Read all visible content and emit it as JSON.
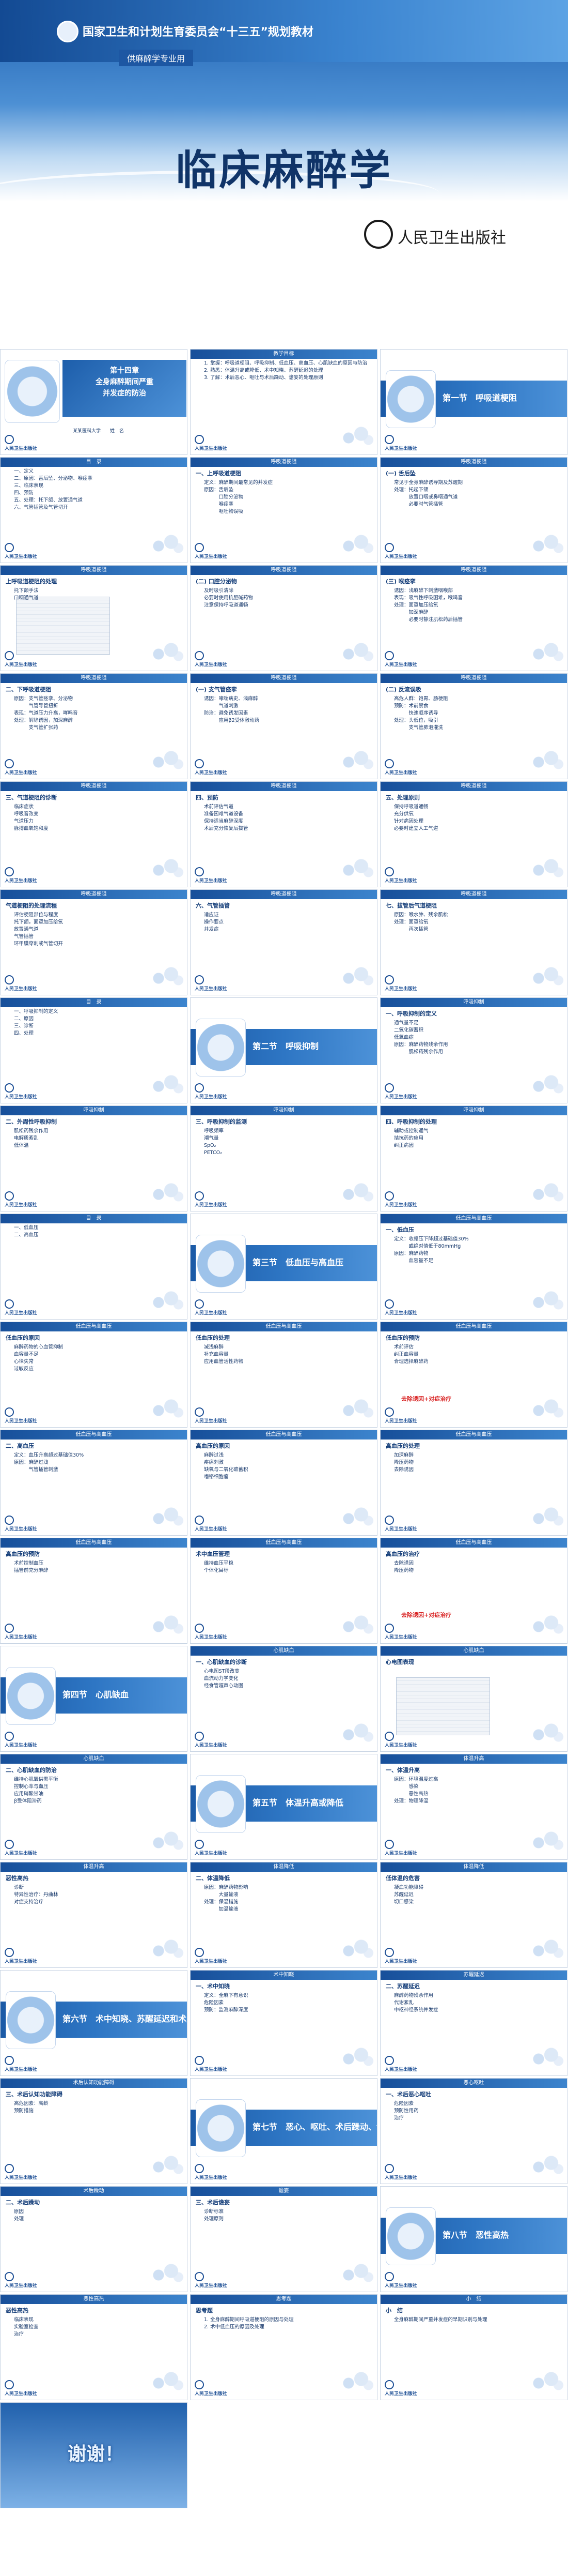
{
  "cover": {
    "series": "国家卫生和计划生育委员会“十三五”规划教材",
    "subtitle": "供麻醉学专业用",
    "title": "临床麻醉学",
    "publisher": "人民卫生出版社"
  },
  "common": {
    "footer": "人民卫生出版社",
    "header_default": "呼吸道梗阻"
  },
  "slides": [
    {
      "kind": "title",
      "title_lines": [
        "第十四章",
        "全身麻醉期间严重",
        "并发症的防治"
      ],
      "affiliation": "某某医科大学　　姓　名"
    },
    {
      "kind": "text",
      "hdr": "教学目标",
      "ttl": "",
      "items": [
        "1. 掌握：呼吸道梗阻、呼吸抑制、低血压、高血压、心肌缺血的原因与防治",
        "2. 熟悉：体温升高或降低、术中知晓、苏醒延迟的处理",
        "3. 了解：术后恶心、呕吐与术后躁动、谵妄的处理原则"
      ]
    },
    {
      "kind": "section",
      "sect": "第一节　呼吸道梗阻"
    },
    {
      "kind": "text",
      "hdr": "目　录",
      "ttl": "",
      "items": [
        "一、定义",
        "二、原因：舌后坠、分泌物、喉痉挛",
        "三、临床表现",
        "四、预防",
        "五、处理：托下颌、放置通气道",
        "六、气管插管及气管切开"
      ]
    },
    {
      "kind": "text",
      "hdr": "呼吸道梗阻",
      "ttl": "一、上呼吸道梗阻",
      "items": [
        "定义：麻醉期间最常见的并发症",
        "原因：舌后坠",
        "　　　口腔分泌物",
        "　　　喉痉挛",
        "　　　呕吐物误吸"
      ]
    },
    {
      "kind": "text",
      "hdr": "呼吸道梗阻",
      "ttl": "(一) 舌后坠",
      "items": [
        "常见于全身麻醉诱导期及苏醒期",
        "处理：托起下颌",
        "　　　放置口咽或鼻咽通气道",
        "　　　必要时气管插管"
      ]
    },
    {
      "kind": "image",
      "hdr": "呼吸道梗阻",
      "ttl": "上呼吸道梗阻的处理",
      "items": [
        "托下颌手法",
        "口咽通气道"
      ]
    },
    {
      "kind": "text",
      "hdr": "呼吸道梗阻",
      "ttl": "(二) 口腔分泌物",
      "items": [
        "及时吸引清除",
        "必要时使用抗胆碱药物",
        "注意保持呼吸道通畅"
      ]
    },
    {
      "kind": "text",
      "hdr": "呼吸道梗阻",
      "ttl": "(三) 喉痉挛",
      "items": [
        "诱因：浅麻醉下刺激咽喉部",
        "表现：吸气性呼吸困难，喉鸣音",
        "处理：面罩加压给氧",
        "　　　加深麻醉",
        "　　　必要时静注肌松药后插管"
      ]
    },
    {
      "kind": "text",
      "hdr": "呼吸道梗阻",
      "ttl": "二、下呼吸道梗阻",
      "items": [
        "原因：支气管痉挛、分泌物",
        "　　　气管导管扭折",
        "表现：气道压力升高，哮鸣音",
        "处理：解除诱因，加深麻醉",
        "　　　支气管扩张药"
      ]
    },
    {
      "kind": "text",
      "hdr": "呼吸道梗阻",
      "ttl": "(一) 支气管痉挛",
      "items": [
        "诱因：哮喘病史、浅麻醉",
        "　　　气道刺激",
        "防治：避免诱发因素",
        "　　　应用β2受体激动药"
      ]
    },
    {
      "kind": "text",
      "hdr": "呼吸道梗阻",
      "ttl": "(二) 反流误吸",
      "items": [
        "高危人群：饱胃、肠梗阻",
        "预防：术前禁食",
        "　　　快速顺序诱导",
        "处理：头低位，吸引",
        "　　　支气管肺泡灌洗"
      ]
    },
    {
      "kind": "text",
      "hdr": "呼吸道梗阻",
      "ttl": "三、气道梗阻的诊断",
      "items": [
        "临床症状",
        "呼吸音改变",
        "气道压力",
        "脉搏血氧饱和度"
      ]
    },
    {
      "kind": "text",
      "hdr": "呼吸道梗阻",
      "ttl": "四、预防",
      "items": [
        "术前评估气道",
        "准备困难气道设备",
        "保持适当麻醉深度",
        "术后充分恢复后拔管"
      ]
    },
    {
      "kind": "text",
      "hdr": "呼吸道梗阻",
      "ttl": "五、处理原则",
      "items": [
        "保持呼吸道通畅",
        "充分供氧",
        "针对病因处理",
        "必要时建立人工气道"
      ]
    },
    {
      "kind": "text",
      "hdr": "呼吸道梗阻",
      "ttl": "气道梗阻的处理流程",
      "items": [
        "评估梗阻部位与程度",
        "托下颌，面罩加压给氧",
        "放置通气道",
        "气管插管",
        "环甲膜穿刺或气管切开"
      ]
    },
    {
      "kind": "text",
      "hdr": "呼吸道梗阻",
      "ttl": "六、气管插管",
      "items": [
        "适应证",
        "操作要点",
        "并发症"
      ]
    },
    {
      "kind": "text",
      "hdr": "呼吸道梗阻",
      "ttl": "七、拔管后气道梗阻",
      "items": [
        "原因：喉水肿、残余肌松",
        "处理：面罩给氧",
        "　　　再次插管"
      ]
    },
    {
      "kind": "text",
      "hdr": "目　录",
      "ttl": "",
      "items": [
        "一、呼吸抑制的定义",
        "二、原因",
        "三、诊断",
        "四、处理"
      ]
    },
    {
      "kind": "section",
      "sect": "第二节　呼吸抑制"
    },
    {
      "kind": "text",
      "hdr": "呼吸抑制",
      "ttl": "一、呼吸抑制的定义",
      "items": [
        "通气量不足",
        "二氧化碳蓄积",
        "低氧血症",
        "原因：麻醉药物残余作用",
        "　　　肌松药残余作用"
      ]
    },
    {
      "kind": "text",
      "hdr": "呼吸抑制",
      "ttl": "二、外周性呼吸抑制",
      "items": [
        "肌松药残余作用",
        "电解质紊乱",
        "低体温"
      ]
    },
    {
      "kind": "text",
      "hdr": "呼吸抑制",
      "ttl": "三、呼吸抑制的监测",
      "items": [
        "呼吸频率",
        "潮气量",
        "SpO₂",
        "PETCO₂"
      ]
    },
    {
      "kind": "text",
      "hdr": "呼吸抑制",
      "ttl": "四、呼吸抑制的处理",
      "items": [
        "辅助或控制通气",
        "拮抗药的应用",
        "纠正病因"
      ]
    },
    {
      "kind": "text",
      "hdr": "目　录",
      "ttl": "",
      "items": [
        "一、低血压",
        "二、高血压"
      ]
    },
    {
      "kind": "section",
      "sect": "第三节　低血压与高血压"
    },
    {
      "kind": "text",
      "hdr": "低血压与高血压",
      "ttl": "一、低血压",
      "items": [
        "定义：收缩压下降超过基础值30%",
        "　　　或绝对值低于80mmHg",
        "原因：麻醉药物",
        "　　　血容量不足"
      ]
    },
    {
      "kind": "text",
      "hdr": "低血压与高血压",
      "ttl": "低血压的原因",
      "items": [
        "麻醉药物的心血管抑制",
        "血容量不足",
        "心律失常",
        "过敏反应"
      ]
    },
    {
      "kind": "text",
      "hdr": "低血压与高血压",
      "ttl": "低血压的处理",
      "items": [
        "减浅麻醉",
        "补充血容量",
        "应用血管活性药物"
      ]
    },
    {
      "kind": "note",
      "hdr": "低血压与高血压",
      "ttl": "低血压的预防",
      "items": [
        "术前评估",
        "纠正血容量",
        "合理选择麻醉药"
      ],
      "note": "去除诱因+对症治疗"
    },
    {
      "kind": "text",
      "hdr": "低血压与高血压",
      "ttl": "二、高血压",
      "items": [
        "定义：血压升高超过基础值30%",
        "原因：麻醉过浅",
        "　　　气管插管刺激"
      ]
    },
    {
      "kind": "text",
      "hdr": "低血压与高血压",
      "ttl": "高血压的原因",
      "items": [
        "麻醉过浅",
        "疼痛刺激",
        "缺氧与二氧化碳蓄积",
        "嗜铬细胞瘤"
      ]
    },
    {
      "kind": "text",
      "hdr": "低血压与高血压",
      "ttl": "高血压的处理",
      "items": [
        "加深麻醉",
        "降压药物",
        "去除诱因"
      ]
    },
    {
      "kind": "text",
      "hdr": "低血压与高血压",
      "ttl": "高血压的预防",
      "items": [
        "术前控制血压",
        "插管前充分麻醉"
      ]
    },
    {
      "kind": "text",
      "hdr": "低血压与高血压",
      "ttl": "术中血压管理",
      "items": [
        "维持血压平稳",
        "个体化目标"
      ]
    },
    {
      "kind": "note",
      "hdr": "低血压与高血压",
      "ttl": "高血压的治疗",
      "items": [
        "去除诱因",
        "降压药物"
      ],
      "note": "去除诱因+对症治疗"
    },
    {
      "kind": "section",
      "sect": "第四节　心肌缺血"
    },
    {
      "kind": "text",
      "hdr": "心肌缺血",
      "ttl": "一、心肌缺血的诊断",
      "items": [
        "心电图ST段改变",
        "血流动力学变化",
        "经食管超声心动图"
      ]
    },
    {
      "kind": "image",
      "hdr": "心肌缺血",
      "ttl": "心电图表现",
      "items": []
    },
    {
      "kind": "text",
      "hdr": "心肌缺血",
      "ttl": "二、心肌缺血的防治",
      "items": [
        "维持心肌氧供需平衡",
        "控制心率与血压",
        "应用硝酸甘油",
        "β受体阻滞药"
      ]
    },
    {
      "kind": "section",
      "sect": "第五节　体温升高或降低"
    },
    {
      "kind": "text",
      "hdr": "体温升高",
      "ttl": "一、体温升高",
      "items": [
        "原因：环境温度过高",
        "　　　感染",
        "　　　恶性高热",
        "处理：物理降温"
      ]
    },
    {
      "kind": "text",
      "hdr": "体温升高",
      "ttl": "恶性高热",
      "items": [
        "诊断",
        "特异性治疗：丹曲林",
        "对症支持治疗"
      ]
    },
    {
      "kind": "text",
      "hdr": "体温降低",
      "ttl": "二、体温降低",
      "items": [
        "原因：麻醉药物影响",
        "　　　大量输液",
        "处理：保温措施",
        "　　　加温输液"
      ]
    },
    {
      "kind": "text",
      "hdr": "体温降低",
      "ttl": "低体温的危害",
      "items": [
        "凝血功能障碍",
        "苏醒延迟",
        "切口感染"
      ]
    },
    {
      "kind": "section",
      "sect": "第六节　术中知晓、苏醒延迟和术后认知功能障碍"
    },
    {
      "kind": "text",
      "hdr": "术中知晓",
      "ttl": "一、术中知晓",
      "items": [
        "定义：全麻下有意识",
        "危险因素",
        "预防：监测麻醉深度"
      ]
    },
    {
      "kind": "text",
      "hdr": "苏醒延迟",
      "ttl": "二、苏醒延迟",
      "items": [
        "麻醉药物残余作用",
        "代谢紊乱",
        "中枢神经系统并发症"
      ]
    },
    {
      "kind": "text",
      "hdr": "术后认知功能障碍",
      "ttl": "三、术后认知功能障碍",
      "items": [
        "高危因素：高龄",
        "预防措施"
      ]
    },
    {
      "kind": "section",
      "sect": "第七节　恶心、呕吐、术后躁动、谵妄"
    },
    {
      "kind": "text",
      "hdr": "恶心呕吐",
      "ttl": "一、术后恶心呕吐",
      "items": [
        "危险因素",
        "预防性用药",
        "治疗"
      ]
    },
    {
      "kind": "text",
      "hdr": "术后躁动",
      "ttl": "二、术后躁动",
      "items": [
        "原因",
        "处理"
      ]
    },
    {
      "kind": "text",
      "hdr": "谵妄",
      "ttl": "三、术后谵妄",
      "items": [
        "诊断标准",
        "处理原则"
      ]
    },
    {
      "kind": "section",
      "sect": "第八节　恶性高热"
    },
    {
      "kind": "text",
      "hdr": "恶性高热",
      "ttl": "恶性高热",
      "items": [
        "临床表现",
        "实验室检查",
        "治疗"
      ]
    },
    {
      "kind": "text",
      "hdr": "思考题",
      "ttl": "思考题",
      "items": [
        "1. 全身麻醉期间呼吸道梗阻的原因与处理",
        "2. 术中低血压的原因及处理"
      ]
    },
    {
      "kind": "text",
      "hdr": "小　结",
      "ttl": "小　结",
      "items": [
        "全身麻醉期间严重并发症的早期识别与处理"
      ]
    },
    {
      "kind": "end",
      "thanks": "谢谢！"
    }
  ]
}
